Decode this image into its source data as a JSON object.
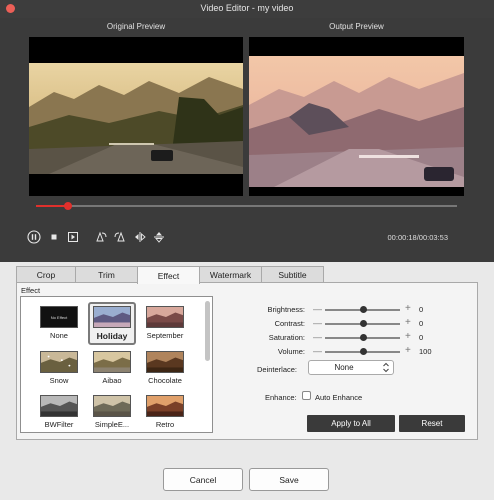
{
  "window": {
    "title": "Video Editor - my video"
  },
  "preview": {
    "original_label": "Original Preview",
    "output_label": "Output Preview",
    "progress": 0.075,
    "time_readout": "00:00:18/00:03:53"
  },
  "controls": {
    "icons": [
      "pause-icon",
      "stop-icon",
      "next-frame-icon",
      "rotate-left-icon",
      "rotate-right-icon",
      "flip-horizontal-icon",
      "flip-vertical-icon"
    ]
  },
  "tabs": [
    "Crop",
    "Trim",
    "Effect",
    "Watermark",
    "Subtitle"
  ],
  "active_tab": "Effect",
  "effect_panel": {
    "group_label": "Effect",
    "none_thumb_text": "No Effect",
    "items": [
      "None",
      "Holiday",
      "September",
      "Snow",
      "Aibao",
      "Chocolate",
      "BWFilter",
      "SimpleE...",
      "Retro"
    ],
    "selected": "Holiday"
  },
  "adjustments": {
    "brightness": {
      "label": "Brightness:",
      "value": "0",
      "level": 0.5
    },
    "contrast": {
      "label": "Contrast:",
      "value": "0",
      "level": 0.5
    },
    "saturation": {
      "label": "Saturation:",
      "value": "0",
      "level": 0.5
    },
    "volume": {
      "label": "Volume:",
      "value": "100",
      "level": 0.5
    },
    "minus": "—",
    "plus": "+"
  },
  "deinterlace": {
    "label": "Deinterlace:",
    "value": "None"
  },
  "enhance": {
    "label": "Enhance:",
    "checkbox_label": "Auto Enhance",
    "checked": false
  },
  "buttons": {
    "apply_all": "Apply to All",
    "reset": "Reset",
    "cancel": "Cancel",
    "save": "Save"
  },
  "colors": {
    "accent": "#e0302c",
    "dark_button": "#3a3a3a"
  }
}
